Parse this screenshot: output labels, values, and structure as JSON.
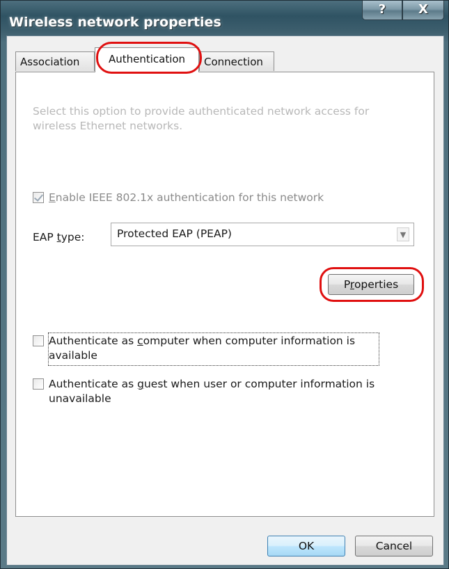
{
  "window": {
    "title": "Wireless network properties",
    "help_glyph": "?",
    "close_glyph": "X"
  },
  "tabs": [
    {
      "label": "Association",
      "active": false
    },
    {
      "label": "Authentication",
      "active": true
    },
    {
      "label": "Connection",
      "active": false
    }
  ],
  "authentication": {
    "description": "Select this option to provide authenticated network access for wireless Ethernet networks.",
    "enable_8021x": {
      "mnemonic": "E",
      "label_rest": "nable IEEE 802.1x authentication for this network",
      "checked": true,
      "disabled": true
    },
    "eap_type": {
      "label_pre": "EAP ",
      "mnemonic": "t",
      "label_rest": "ype:",
      "selected": "Protected EAP (PEAP)",
      "arrow_glyph": "▼"
    },
    "properties_button": {
      "label_pre": "P",
      "mnemonic": "r",
      "label_rest": "operties"
    },
    "auth_as_computer": {
      "label_pre": "Authenticate as ",
      "mnemonic": "c",
      "label_rest": "omputer when computer information is available",
      "checked": false
    },
    "auth_as_guest": {
      "label_pre": "Authenticate as ",
      "mnemonic": "g",
      "label_rest": "uest when user or computer information is unavailable",
      "checked": false
    }
  },
  "footer": {
    "ok_label": "OK",
    "cancel_label": "Cancel"
  },
  "colors": {
    "annotation_ring": "#e01010",
    "titlebar": "#2f5363",
    "panel": "#ffffff"
  }
}
